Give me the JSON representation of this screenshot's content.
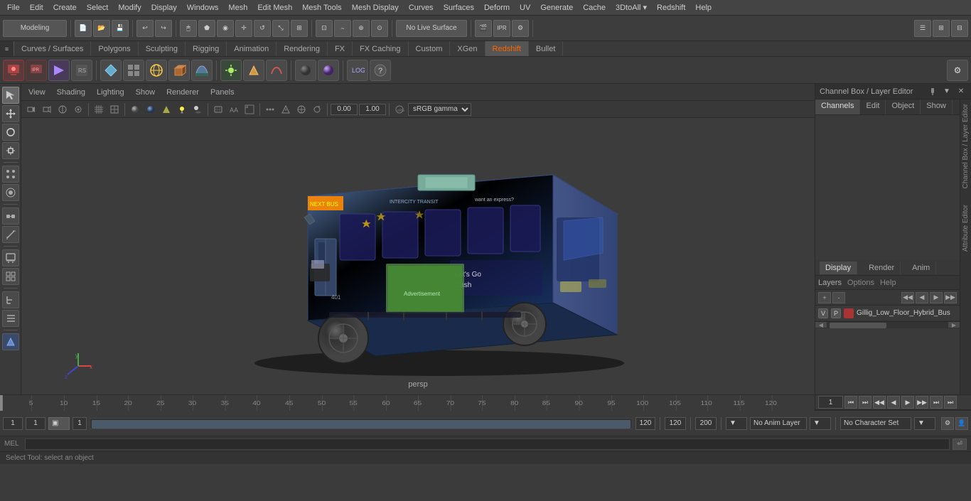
{
  "menu_bar": {
    "items": [
      "File",
      "Edit",
      "Create",
      "Select",
      "Modify",
      "Display",
      "Windows",
      "Mesh",
      "Edit Mesh",
      "Mesh Tools",
      "Mesh Display",
      "Curves",
      "Surfaces",
      "Deform",
      "UV",
      "Generate",
      "Cache",
      "3DtoAll ▾",
      "Redshift",
      "Help"
    ]
  },
  "toolbar": {
    "workspace_label": "Modeling",
    "no_live_surface": "No Live Surface",
    "color_space": "sRGB gamma"
  },
  "shelf_tabs": {
    "items": [
      "Curves / Surfaces",
      "Polygons",
      "Sculpting",
      "Rigging",
      "Animation",
      "Rendering",
      "FX",
      "FX Caching",
      "Custom",
      "XGen",
      "Redshift",
      "Bullet"
    ],
    "active": "Redshift"
  },
  "viewport": {
    "menu_items": [
      "View",
      "Shading",
      "Lighting",
      "Show",
      "Renderer",
      "Panels"
    ],
    "label": "persp",
    "camera_value": "0.00",
    "scale_value": "1.00"
  },
  "channel_box": {
    "title": "Channel Box / Layer Editor",
    "tabs": [
      "Channels",
      "Edit",
      "Object",
      "Show"
    ]
  },
  "layer_editor": {
    "tabs": [
      "Display",
      "Render",
      "Anim"
    ],
    "active_tab": "Display",
    "sub_tabs": [
      "Layers",
      "Options",
      "Help"
    ],
    "layers": [
      {
        "visibility": "V",
        "type": "P",
        "color": "#aa3333",
        "name": "Gillig_Low_Floor_Hybrid_Bus"
      }
    ]
  },
  "timeline": {
    "start": "1",
    "end": "120",
    "current": "1",
    "playback_speed": "120",
    "max_time": "200",
    "ticks": [
      {
        "pos": 4,
        "label": "5"
      },
      {
        "pos": 8,
        "label": "10"
      },
      {
        "pos": 12,
        "label": "15"
      },
      {
        "pos": 17,
        "label": "20"
      },
      {
        "pos": 21,
        "label": "25"
      },
      {
        "pos": 25,
        "label": "30"
      },
      {
        "pos": 29,
        "label": "35"
      },
      {
        "pos": 34,
        "label": "40"
      },
      {
        "pos": 38,
        "label": "45"
      },
      {
        "pos": 42,
        "label": "50"
      },
      {
        "pos": 46,
        "label": "55"
      },
      {
        "pos": 50,
        "label": "60"
      },
      {
        "pos": 55,
        "label": "65"
      },
      {
        "pos": 59,
        "label": "70"
      },
      {
        "pos": 63,
        "label": "75"
      },
      {
        "pos": 67,
        "label": "80"
      },
      {
        "pos": 71,
        "label": "85"
      },
      {
        "pos": 76,
        "label": "90"
      },
      {
        "pos": 80,
        "label": "95"
      },
      {
        "pos": 84,
        "label": "100"
      },
      {
        "pos": 88,
        "label": "105"
      },
      {
        "pos": 93,
        "label": "110"
      },
      {
        "pos": 97,
        "label": "115"
      },
      {
        "pos": 101,
        "label": "120"
      }
    ]
  },
  "status_bar": {
    "frame_start": "1",
    "frame_current": "1",
    "range_start": "1",
    "range_end": "120",
    "playback_speed": "120",
    "max_frame": "200",
    "anim_layer": "No Anim Layer",
    "char_set": "No Character Set"
  },
  "command_line": {
    "type": "MEL",
    "content": ""
  },
  "help_text": "Select Tool: select an object",
  "playback_buttons": [
    "⏮",
    "⏭",
    "◀◀",
    "◀",
    "▶",
    "▶▶",
    "⏭",
    "⏭"
  ],
  "icons": {
    "gear": "⚙",
    "expand": "▶",
    "collapse": "▼",
    "close": "✕",
    "arrow_left": "◀",
    "arrow_right": "▶",
    "add": "+",
    "remove": "-"
  }
}
